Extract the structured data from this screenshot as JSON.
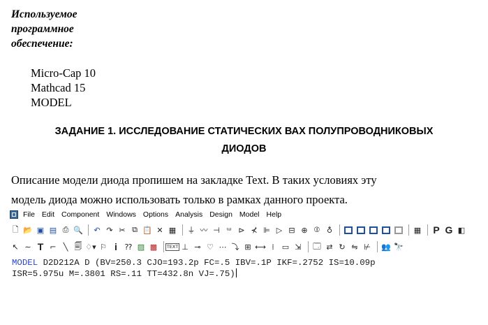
{
  "heading": {
    "lines": [
      "Используемое",
      "программное",
      "обеспечение:"
    ]
  },
  "software": {
    "items": [
      "Micro-Cap 10",
      "Mathcad 15",
      "MODEL"
    ]
  },
  "task": {
    "lines": [
      "ЗАДАНИЕ 1.  ИССЛЕДОВАНИЕ СТАТИЧЕСКИХ ВАХ ПОЛУПРОВОДНИКОВЫХ",
      "ДИОДОВ"
    ]
  },
  "paragraph": {
    "lines": [
      "Описание модели диода пропишем на закладке Text. В таких условиях эту",
      "модель диода можно использовать только в рамках данного проекта."
    ]
  },
  "app": {
    "menu": [
      "File",
      "Edit",
      "Component",
      "Windows",
      "Options",
      "Analysis",
      "Design",
      "Model",
      "Help"
    ],
    "toolbar2_text_button": "TEXT",
    "toolbar1_letters": [
      "P",
      "G"
    ]
  },
  "code": {
    "keyword": "MODEL",
    "line1_rest": " D2D212A D (BV=250.3 CJO=193.2p FC=.5 IBV=.1P IKF=.2752 IS=10.09p",
    "line2": "ISR=5.975u M=.3801 RS=.11 TT=432.8n VJ=.75)"
  }
}
